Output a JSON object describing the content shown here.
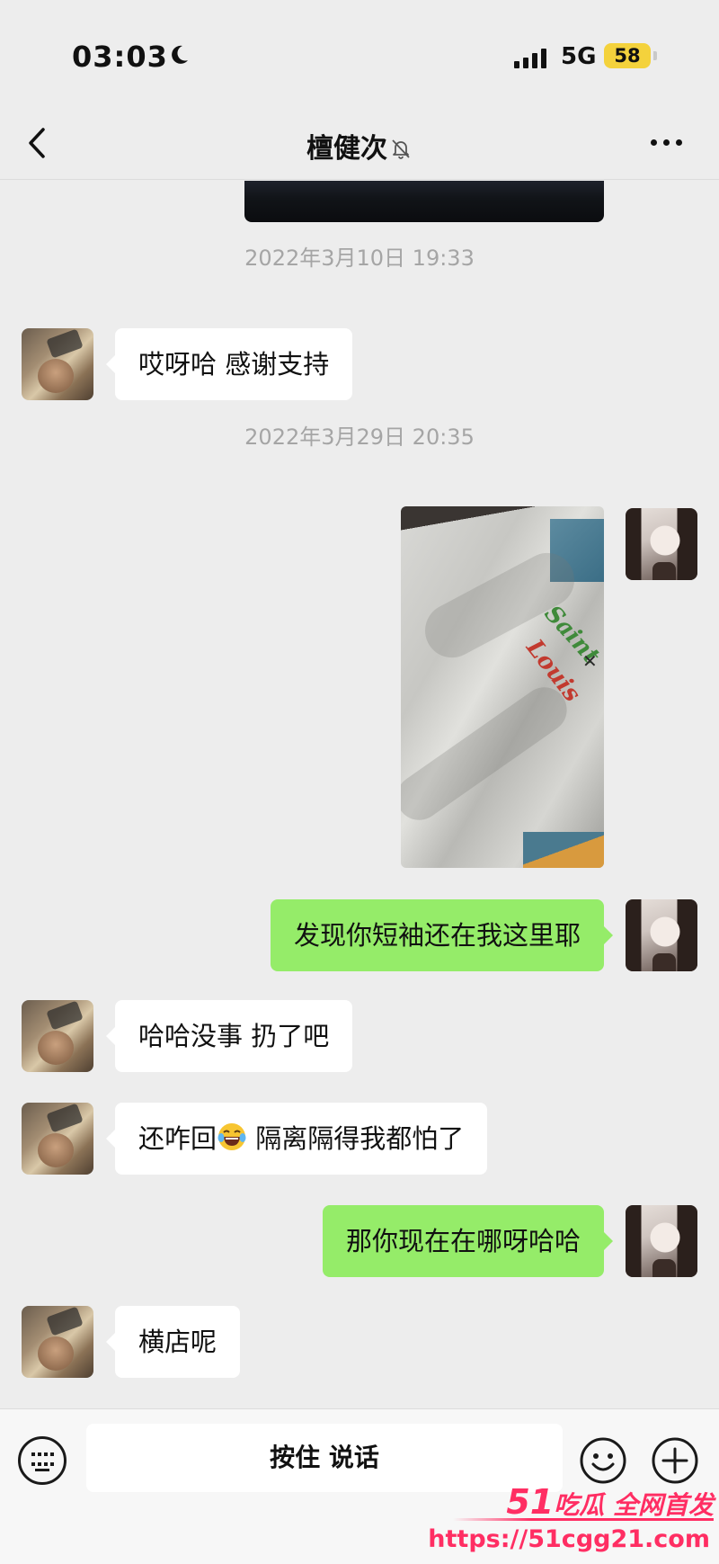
{
  "status_bar": {
    "time": "03:03",
    "network": "5G",
    "battery": "58"
  },
  "nav": {
    "title": "檀健次"
  },
  "chat": {
    "timestamps": [
      "2022年3月10日 19:33",
      "2022年3月29日 20:35"
    ],
    "messages": [
      {
        "from": "contact",
        "text": "哎呀哈 感谢支持"
      },
      {
        "from": "me",
        "type": "image",
        "image_text": [
          "Saint",
          "Louis"
        ]
      },
      {
        "from": "me",
        "text": "发现你短袖还在我这里耶"
      },
      {
        "from": "contact",
        "text": "哈哈没事 扔了吧"
      },
      {
        "from": "contact",
        "text_before": "还咋回",
        "emoji": "laughing-tears",
        "text_after": " 隔离隔得我都怕了"
      },
      {
        "from": "me",
        "text": "那你现在在哪呀哈哈"
      },
      {
        "from": "contact",
        "text": "横店呢"
      }
    ]
  },
  "input_bar": {
    "hold_to_talk": "按住 说话"
  },
  "watermark": {
    "num": "51",
    "brand": "吃瓜 全网首发",
    "url": "https://51cgg21.com"
  },
  "colors": {
    "background": "#ededed",
    "outgoing_bubble": "#95ec69",
    "incoming_bubble": "#ffffff",
    "watermark": "#ff2e63",
    "battery": "#f4d23c"
  }
}
